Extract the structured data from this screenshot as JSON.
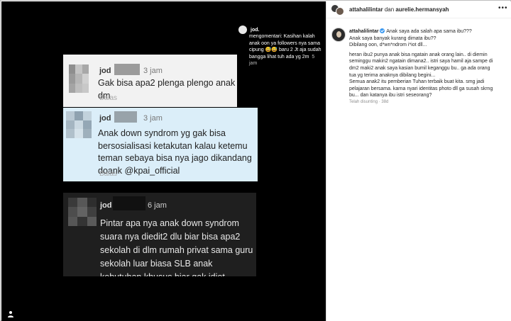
{
  "overlay_comment": {
    "username": "jod.",
    "text": "mengomentari: Kasihan kalah anak oon ya followers nya sama cipung 😅😅 baru 2 Jt aja sudah bangga lihat tuh ada yg 2m",
    "time": "5 jam"
  },
  "comment1": {
    "username": "jod",
    "time": "3 jam",
    "text": "Gak bisa apa2 plenga plengo anak dm",
    "reply_label": "Balas"
  },
  "comment2": {
    "username": "jod",
    "time": "3 jam",
    "text": "Anak down syndrom yg gak bisa bersosialisasi ketakutan kalau ketemu teman sebaya bisa nya jago dikandang doank @kpai_official",
    "reply_label": "Balas"
  },
  "comment3": {
    "username": "jod",
    "time": "6 jam",
    "text": "Pintar apa nya anak down syndrom suara nya diedit2 dlu biar bisa apa2 sekolah di dlm rumah privat sama guru sekolah luar biasa SLB anak kebutuhan khusus biar gak idiot"
  },
  "sidebar": {
    "header": {
      "user1": "attahalilintar",
      "connector": "dan",
      "user2": "aurelie.hermansyah",
      "more": "•••"
    },
    "caption": {
      "username": "attahalilintar",
      "lines": [
        "Anak saya ada salah apa sama ibu???",
        "Anak saya banyak kurang dimata ibu??",
        "Dibilang oon, d*wn*ndrom i*iot dll...",
        "",
        "heran ibu2 punya anak bisa ngatain anak orang lain.. di diemin",
        "seminggu makin2 ngatain dimana2.. istri saya hamil aja sampe di",
        "dm2 maki2 anak saya kasian bumil keganggu bu.. ga ada orang",
        "tua yg terima anaknya dibilang begini...",
        "Semua anak2 itu pemberian Tuhan terbaik buat kita. smg jadi",
        "pelajaran bersama. karna nyari identitas photo dll ga susah skrng",
        "bu... dan katanya ibu istri seseorang?"
      ]
    },
    "meta": "Telah disunting · 38d"
  },
  "colors": {
    "avatar_blur1": [
      "#8e8e8e",
      "#c4c4c4",
      "#a8a8a8",
      "#9a9a9a",
      "#b6b6b6",
      "#d0d0d0",
      "#a4a4a4",
      "#bebebe",
      "#c8c8c8"
    ],
    "avatar_blur2": [
      "#b9c8d3",
      "#8fa2b0",
      "#c2d2dc",
      "#a4b5c1",
      "#cbd9e2",
      "#94a7b5",
      "#b0c0cb",
      "#d5e2ea",
      "#9fb0bc"
    ],
    "avatar_blur3": [
      "#3a3a3a",
      "#575757",
      "#2e2e2e",
      "#4d4d4d",
      "#636363",
      "#3f3f3f",
      "#565656",
      "#343434",
      "#5a5a5a"
    ]
  }
}
